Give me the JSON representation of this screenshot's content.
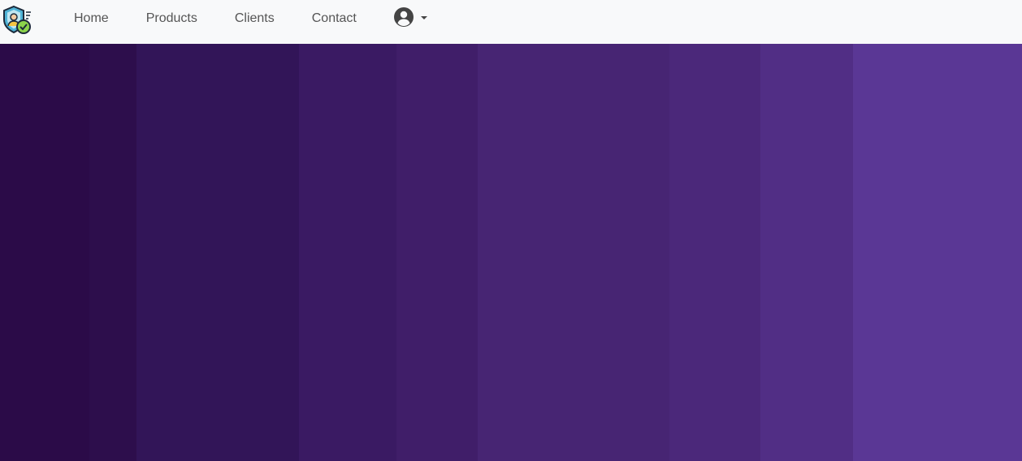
{
  "navbar": {
    "brand_icon": "shield-user-check-logo",
    "links": [
      {
        "label": "Home"
      },
      {
        "label": "Products"
      },
      {
        "label": "Clients"
      },
      {
        "label": "Contact"
      }
    ],
    "user_icon": "user-circle-icon",
    "background": "#f8f9fa"
  },
  "hero": {
    "stripes": [
      {
        "color": "#2b0b48"
      },
      {
        "color": "#2d0e4c"
      },
      {
        "color": "#321558"
      },
      {
        "color": "#3a1a63"
      },
      {
        "color": "#401e69"
      },
      {
        "color": "#472573"
      },
      {
        "color": "#4b287a"
      },
      {
        "color": "#512e85"
      },
      {
        "color": "#5a3795"
      }
    ]
  }
}
